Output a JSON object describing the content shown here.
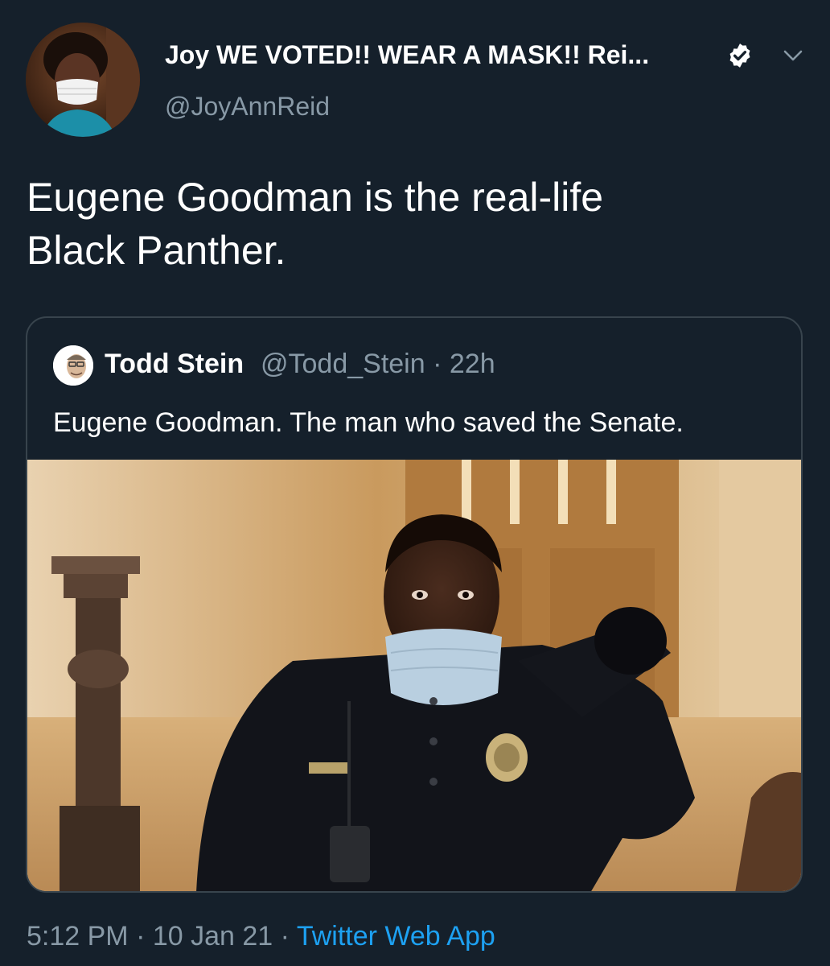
{
  "author": {
    "display_name": "Joy WE VOTED!! WEAR A MASK!! Rei...",
    "handle": "@JoyAnnReid",
    "avatar_icon": "user-avatar-icon",
    "verified_icon": "verified-badge-icon",
    "menu_icon": "chevron-down-icon"
  },
  "tweet": {
    "text_line1": "Eugene Goodman is the real-life",
    "text_line2": "Black Panther."
  },
  "quoted_tweet": {
    "display_name": "Todd Stein",
    "handle": "@Todd_Stein",
    "separator": "·",
    "age": "22h",
    "text": "Eugene Goodman. The man who saved the Senate.",
    "photo_icon": "photo-image"
  },
  "footer": {
    "time": "5:12 PM",
    "separator": "·",
    "date": "10 Jan 21",
    "source": "Twitter Web App"
  },
  "colors": {
    "background": "#15202b",
    "secondary_text": "#8899a6",
    "link": "#1da1f2",
    "border": "#38444d"
  }
}
